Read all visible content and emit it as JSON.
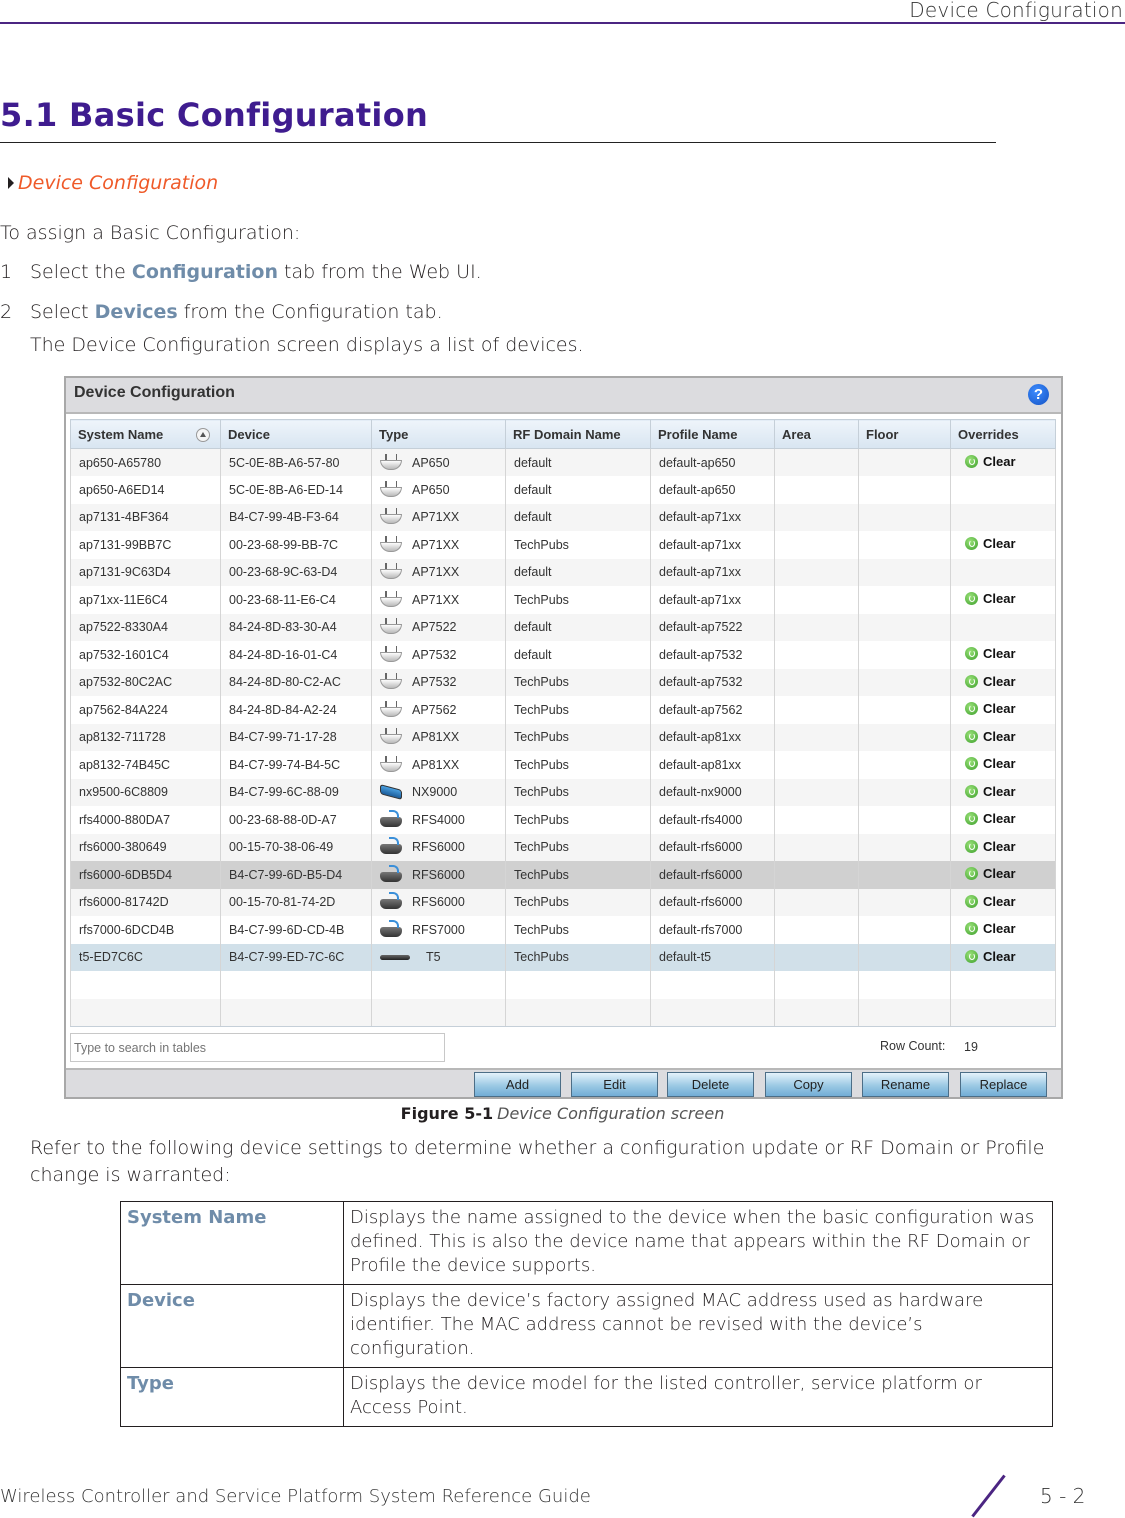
{
  "header": {
    "running_title": "Device Configuration"
  },
  "section": {
    "title": "5.1 Basic Configuration",
    "xref": "Device Configuration",
    "intro": "To assign a Basic Configuration:",
    "steps": [
      {
        "num": "1",
        "pre": "Select the ",
        "term": "Configuration",
        "post": " tab from the Web UI."
      },
      {
        "num": "2",
        "pre": "Select ",
        "term": "Devices",
        "post": " from the Configuration tab."
      }
    ],
    "step_note": "The Device Configuration screen displays a list of devices."
  },
  "screen": {
    "title": "Device Configuration",
    "help_icon": "question-mark-icon",
    "columns": [
      "System Name",
      "Device",
      "Type",
      "RF Domain Name",
      "Profile Name",
      "Area",
      "Floor",
      "Overrides"
    ],
    "rows": [
      {
        "system_name": "ap650-A65780",
        "device": "5C-0E-8B-A6-57-80",
        "icon": "ap",
        "type": "AP650",
        "rf_domain": "default",
        "profile": "default-ap650",
        "area": "",
        "floor": "",
        "override": "Clear"
      },
      {
        "system_name": "ap650-A6ED14",
        "device": "5C-0E-8B-A6-ED-14",
        "icon": "ap",
        "type": "AP650",
        "rf_domain": "default",
        "profile": "default-ap650",
        "area": "",
        "floor": "",
        "override": ""
      },
      {
        "system_name": "ap7131-4BF364",
        "device": "B4-C7-99-4B-F3-64",
        "icon": "ap",
        "type": "AP71XX",
        "rf_domain": "default",
        "profile": "default-ap71xx",
        "area": "",
        "floor": "",
        "override": ""
      },
      {
        "system_name": "ap7131-99BB7C",
        "device": "00-23-68-99-BB-7C",
        "icon": "ap",
        "type": "AP71XX",
        "rf_domain": "TechPubs",
        "profile": "default-ap71xx",
        "area": "",
        "floor": "",
        "override": "Clear"
      },
      {
        "system_name": "ap7131-9C63D4",
        "device": "00-23-68-9C-63-D4",
        "icon": "ap",
        "type": "AP71XX",
        "rf_domain": "default",
        "profile": "default-ap71xx",
        "area": "",
        "floor": "",
        "override": ""
      },
      {
        "system_name": "ap71xx-11E6C4",
        "device": "00-23-68-11-E6-C4",
        "icon": "ap",
        "type": "AP71XX",
        "rf_domain": "TechPubs",
        "profile": "default-ap71xx",
        "area": "",
        "floor": "",
        "override": "Clear"
      },
      {
        "system_name": "ap7522-8330A4",
        "device": "84-24-8D-83-30-A4",
        "icon": "ap",
        "type": "AP7522",
        "rf_domain": "default",
        "profile": "default-ap7522",
        "area": "",
        "floor": "",
        "override": ""
      },
      {
        "system_name": "ap7532-1601C4",
        "device": "84-24-8D-16-01-C4",
        "icon": "ap",
        "type": "AP7532",
        "rf_domain": "default",
        "profile": "default-ap7532",
        "area": "",
        "floor": "",
        "override": "Clear"
      },
      {
        "system_name": "ap7532-80C2AC",
        "device": "84-24-8D-80-C2-AC",
        "icon": "ap",
        "type": "AP7532",
        "rf_domain": "TechPubs",
        "profile": "default-ap7532",
        "area": "",
        "floor": "",
        "override": "Clear"
      },
      {
        "system_name": "ap7562-84A224",
        "device": "84-24-8D-84-A2-24",
        "icon": "ap",
        "type": "AP7562",
        "rf_domain": "TechPubs",
        "profile": "default-ap7562",
        "area": "",
        "floor": "",
        "override": "Clear"
      },
      {
        "system_name": "ap8132-711728",
        "device": "B4-C7-99-71-17-28",
        "icon": "ap",
        "type": "AP81XX",
        "rf_domain": "TechPubs",
        "profile": "default-ap81xx",
        "area": "",
        "floor": "",
        "override": "Clear"
      },
      {
        "system_name": "ap8132-74B45C",
        "device": "B4-C7-99-74-B4-5C",
        "icon": "ap",
        "type": "AP81XX",
        "rf_domain": "TechPubs",
        "profile": "default-ap81xx",
        "area": "",
        "floor": "",
        "override": "Clear"
      },
      {
        "system_name": "nx9500-6C8809",
        "device": "B4-C7-99-6C-88-09",
        "icon": "nx",
        "type": "NX9000",
        "rf_domain": "TechPubs",
        "profile": "default-nx9000",
        "area": "",
        "floor": "",
        "override": "Clear"
      },
      {
        "system_name": "rfs4000-880DA7",
        "device": "00-23-68-88-0D-A7",
        "icon": "rfs",
        "type": "RFS4000",
        "rf_domain": "TechPubs",
        "profile": "default-rfs4000",
        "area": "",
        "floor": "",
        "override": "Clear"
      },
      {
        "system_name": "rfs6000-380649",
        "device": "00-15-70-38-06-49",
        "icon": "rfs",
        "type": "RFS6000",
        "rf_domain": "TechPubs",
        "profile": "default-rfs6000",
        "area": "",
        "floor": "",
        "override": "Clear"
      },
      {
        "system_name": "rfs6000-6DB5D4",
        "device": "B4-C7-99-6D-B5-D4",
        "icon": "rfs",
        "type": "RFS6000",
        "rf_domain": "TechPubs",
        "profile": "default-rfs6000",
        "area": "",
        "floor": "",
        "override": "Clear",
        "state": "sel-gray"
      },
      {
        "system_name": "rfs6000-81742D",
        "device": "00-15-70-81-74-2D",
        "icon": "rfs",
        "type": "RFS6000",
        "rf_domain": "TechPubs",
        "profile": "default-rfs6000",
        "area": "",
        "floor": "",
        "override": "Clear"
      },
      {
        "system_name": "rfs7000-6DCD4B",
        "device": "B4-C7-99-6D-CD-4B",
        "icon": "rfs",
        "type": "RFS7000",
        "rf_domain": "TechPubs",
        "profile": "default-rfs7000",
        "area": "",
        "floor": "",
        "override": "Clear"
      },
      {
        "system_name": "t5-ED7C6C",
        "device": "B4-C7-99-ED-7C-6C",
        "icon": "t5",
        "type": "T5",
        "rf_domain": "TechPubs",
        "profile": "default-t5",
        "area": "",
        "floor": "",
        "override": "Clear",
        "state": "sel-blue"
      }
    ],
    "empty_rows": 2,
    "search_placeholder": "Type to search in tables",
    "row_count_label": "Row Count:",
    "row_count": "19",
    "buttons": [
      "Add",
      "Edit",
      "Delete",
      "Copy",
      "Rename",
      "Replace"
    ]
  },
  "figure": {
    "label": "Figure 5-1",
    "caption": "Device Configuration screen"
  },
  "after_text": "Refer to the following device settings to determine whether a configuration update or RF Domain or Profile change is warranted:",
  "definitions": [
    {
      "term": "System Name",
      "desc": "Displays the name assigned to the device when the basic configuration was defined. This is also the device name that appears within the RF Domain or Profile the device supports."
    },
    {
      "term": "Device",
      "desc": "Displays the device’s factory assigned MAC address used as hardware identifier. The MAC address cannot be revised with the device’s configuration."
    },
    {
      "term": "Type",
      "desc": "Displays the device model for the listed controller, service platform or Access Point."
    }
  ],
  "footer": {
    "guide_title": "Wireless Controller and Service Platform System Reference Guide",
    "page": "5 - 2"
  }
}
